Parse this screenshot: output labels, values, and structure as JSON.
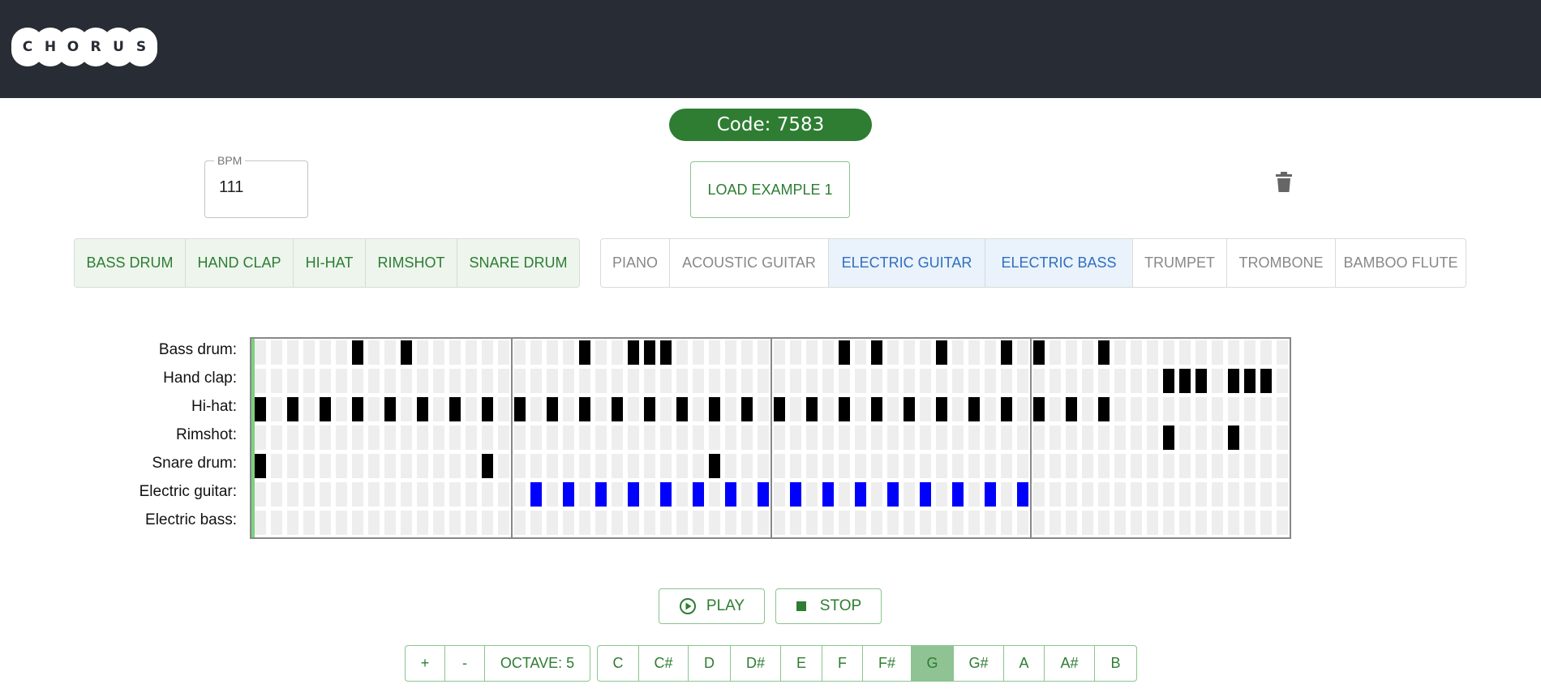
{
  "header": {
    "logo_letters": [
      "C",
      "H",
      "O",
      "R",
      "U",
      "S"
    ]
  },
  "session": {
    "code_label": "Code: 7583"
  },
  "bpm": {
    "label": "BPM",
    "value": "111"
  },
  "load_example_label": "LOAD EXAMPLE 1",
  "drum_tabs": [
    "BASS DRUM",
    "HAND CLAP",
    "HI-HAT",
    "RIMSHOT",
    "SNARE DRUM"
  ],
  "instrument_tabs": [
    "PIANO",
    "ACOUSTIC GUITAR",
    "ELECTRIC GUITAR",
    "ELECTRIC BASS",
    "TRUMPET",
    "TROMBONE",
    "BAMBOO FLUTE"
  ],
  "selected_instruments": [
    "ELECTRIC GUITAR",
    "ELECTRIC BASS"
  ],
  "tracks": [
    {
      "label": "Bass drum:",
      "steps": [
        6,
        9,
        20,
        23,
        24,
        25,
        36,
        38,
        42,
        46,
        48,
        52
      ]
    },
    {
      "label": "Hand clap:",
      "steps": [
        56,
        57,
        58,
        60,
        61,
        62
      ]
    },
    {
      "label": "Hi-hat:",
      "steps": [
        0,
        2,
        4,
        6,
        8,
        10,
        12,
        14,
        16,
        18,
        20,
        22,
        24,
        26,
        28,
        30,
        32,
        34,
        36,
        38,
        40,
        42,
        44,
        46,
        48,
        50,
        52
      ]
    },
    {
      "label": "Rimshot:",
      "steps": [
        56,
        60
      ]
    },
    {
      "label": "Snare drum:",
      "steps": [
        0,
        14,
        28
      ]
    },
    {
      "label": "Electric guitar:",
      "steps": [
        17,
        19,
        21,
        23,
        25,
        27,
        29,
        31,
        33,
        35,
        37,
        39,
        41,
        43,
        45,
        47
      ],
      "color": "#0000ff"
    },
    {
      "label": "Electric bass:",
      "steps": []
    }
  ],
  "sequencer": {
    "bars": 4,
    "steps_per_bar": 16,
    "playhead_step": 0
  },
  "transport": {
    "play_label": "PLAY",
    "stop_label": "STOP"
  },
  "keyboard": {
    "octave_up": "+",
    "octave_down": "-",
    "octave_label": "OCTAVE: 5",
    "notes": [
      "C",
      "C#",
      "D",
      "D#",
      "E",
      "F",
      "F#",
      "G",
      "G#",
      "A",
      "A#",
      "B"
    ],
    "selected_note": "G"
  },
  "colors": {
    "topbar": "#282c34",
    "accent_green": "#2e7d32",
    "note_on": "#000000",
    "guitar_note": "#0000ff",
    "playhead": "#7cd17f"
  }
}
